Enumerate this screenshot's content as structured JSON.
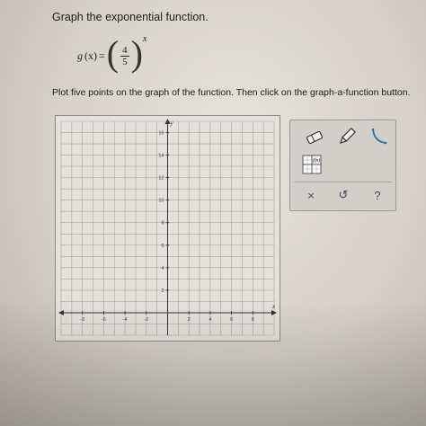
{
  "question": {
    "heading": "Graph the exponential function.",
    "function_name": "g",
    "function_var": "(x)",
    "equals": "=",
    "fraction_numerator": "4",
    "fraction_denominator": "5",
    "exponent": "x",
    "instruction": "Plot five points on the graph of the function. Then click on the graph-a-function button."
  },
  "graph": {
    "x_axis_label": "x",
    "y_axis_label": "y",
    "x_range": [
      -10,
      10
    ],
    "y_range": [
      -2,
      17
    ],
    "x_tick_labels": [
      "-8",
      "-6",
      "-4",
      "-2",
      "2",
      "4",
      "6",
      "8"
    ],
    "y_tick_labels": [
      "16",
      "14",
      "12",
      "10",
      "8",
      "6",
      "4",
      "2"
    ]
  },
  "toolbox": {
    "tools": [
      {
        "name": "eraser",
        "icon": "eraser-icon"
      },
      {
        "name": "pencil",
        "icon": "pencil-icon"
      },
      {
        "name": "curve",
        "icon": "exponential-curve-icon"
      },
      {
        "name": "graph-a-function",
        "icon": "graph-function-icon"
      }
    ],
    "actions": [
      {
        "name": "clear",
        "glyph": "×"
      },
      {
        "name": "undo",
        "glyph": "↺"
      },
      {
        "name": "help",
        "glyph": "?"
      }
    ],
    "accent_color": "#2f6fa8"
  }
}
